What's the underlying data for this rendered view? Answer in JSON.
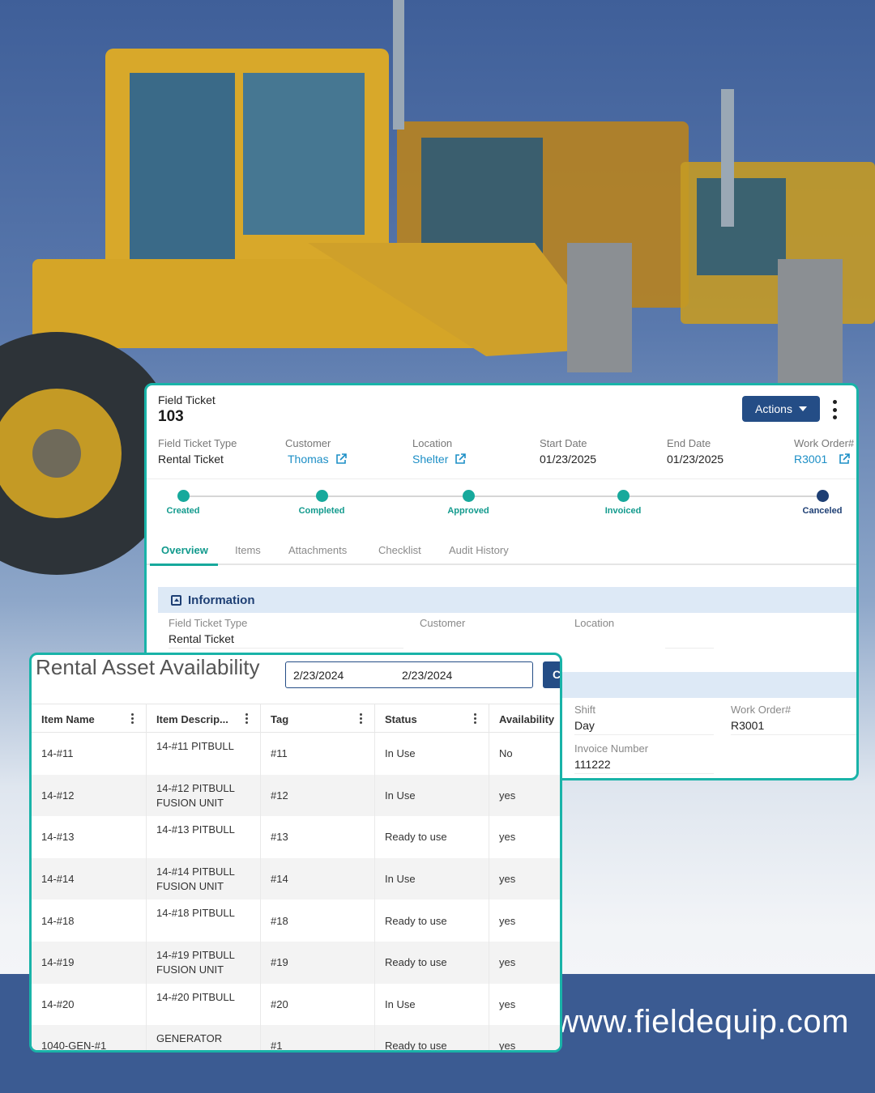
{
  "footer": {
    "url": "www.fieldequip.com"
  },
  "field_ticket": {
    "label": "Field Ticket",
    "number": "103",
    "actions_label": "Actions",
    "meta": [
      {
        "key": "Field Ticket Type",
        "value": "Rental Ticket",
        "link": false
      },
      {
        "key": "Customer",
        "value": "Thomas",
        "link": true
      },
      {
        "key": "Location",
        "value": "Shelter",
        "link": true
      },
      {
        "key": "Start Date",
        "value": "01/23/2025",
        "link": false
      },
      {
        "key": "End Date",
        "value": "01/23/2025",
        "link": false
      },
      {
        "key": "Work Order#",
        "value": "R3001",
        "link": true
      }
    ],
    "steps": [
      "Created",
      "Completed",
      "Approved",
      "Invoiced",
      "Canceled"
    ],
    "tabs": [
      "Overview",
      "Items",
      "Attachments",
      "Checklist",
      "Audit History"
    ],
    "section_title": "Information",
    "info": {
      "type_key": "Field Ticket Type",
      "type_value": "Rental Ticket",
      "customer_key": "Customer",
      "location_key": "Location",
      "shift_key": "Shift",
      "shift_value": "Day",
      "wo_key": "Work Order#",
      "wo_value": "R3001",
      "invoice_key": "Invoice Number",
      "invoice_value": "111222"
    }
  },
  "rental": {
    "title": "Rental Asset Availability",
    "date_from": "2/23/2024",
    "date_to": "2/23/2024",
    "go_label": "C",
    "columns": [
      "Item Name",
      "Item Descrip...",
      "Tag",
      "Status",
      "Availability"
    ],
    "rows": [
      {
        "name": "14-#11",
        "desc": "14-#11 PITBULL",
        "tag": "#11",
        "status": "In Use",
        "avail": "No"
      },
      {
        "name": "14-#12",
        "desc": "14-#12 PITBULL FUSION UNIT",
        "tag": "#12",
        "status": "In Use",
        "avail": "yes"
      },
      {
        "name": "14-#13",
        "desc": "14-#13 PITBULL",
        "tag": "#13",
        "status": "Ready to use",
        "avail": "yes"
      },
      {
        "name": "14-#14",
        "desc": "14-#14 PITBULL FUSION UNIT",
        "tag": "#14",
        "status": "In Use",
        "avail": "yes"
      },
      {
        "name": "14-#18",
        "desc": "14-#18 PITBULL",
        "tag": "#18",
        "status": "Ready to use",
        "avail": "yes"
      },
      {
        "name": "14-#19",
        "desc": "14-#19 PITBULL FUSION UNIT",
        "tag": "#19",
        "status": "Ready to use",
        "avail": "yes"
      },
      {
        "name": "14-#20",
        "desc": "14-#20 PITBULL",
        "tag": "#20",
        "status": "In Use",
        "avail": "yes"
      },
      {
        "name": "1040-GEN-#1",
        "desc": "GENERATOR",
        "tag": "#1",
        "status": "Ready to use",
        "avail": "yes"
      }
    ]
  },
  "colors": {
    "accent": "#19b3a8",
    "primary": "#244d86",
    "link": "#1d8fc6",
    "footer": "#3b5b92"
  },
  "icons": {
    "external_link": "external-link-icon",
    "calendar": "calendar-icon",
    "info_section": "collapse-icon",
    "more": "kebab-icon"
  }
}
